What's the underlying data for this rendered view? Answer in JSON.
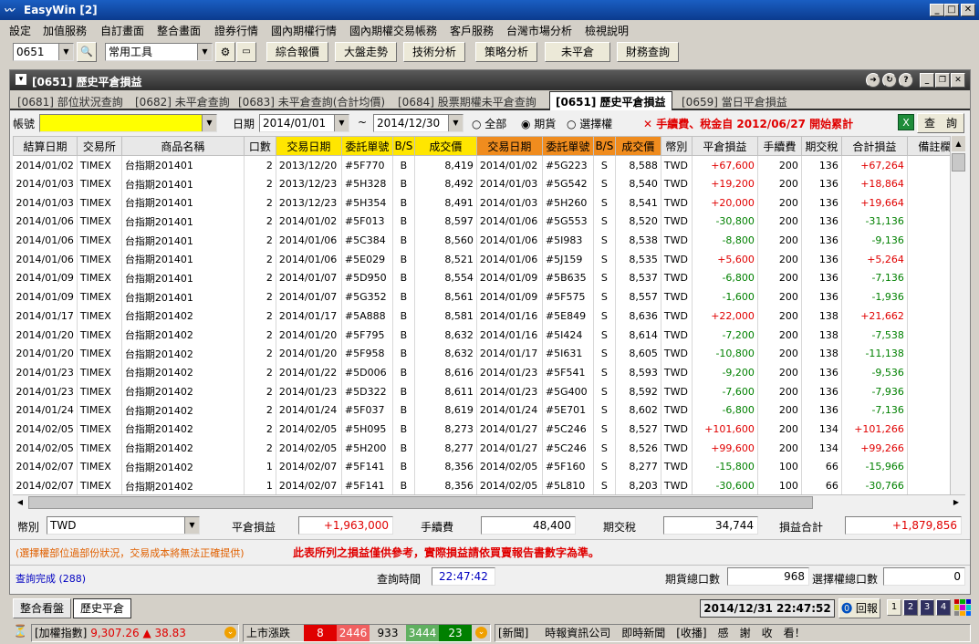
{
  "window": {
    "title": "EasyWin  [2]"
  },
  "menu": [
    "設定",
    "加值服務",
    "自訂畫面",
    "整合畫面",
    "證券行情",
    "國內期權行情",
    "國內期權交易帳務",
    "客戶服務",
    "台灣市場分析",
    "檢視說明"
  ],
  "toolbar": {
    "code": "0651",
    "tools": "常用工具",
    "buttons": [
      "綜合報價",
      "大盤走勢",
      "技術分析",
      "策略分析",
      "未平倉",
      "財務查詢"
    ]
  },
  "panel": {
    "title": "[0651] 歷史平倉損益"
  },
  "tabs": [
    "[0681] 部位狀況查詢",
    "[0682] 未平倉查詢",
    "[0683] 未平倉查詢(合計均價)",
    "[0684] 股票期權未平倉查詢",
    "[0651] 歷史平倉損益",
    "[0659] 當日平倉損益"
  ],
  "filter": {
    "account_label": "帳號",
    "date_label": "日期",
    "date_from": "2014/01/01",
    "tilde": "~",
    "date_to": "2014/12/30",
    "opt_all": "全部",
    "opt_futures": "期貨",
    "opt_options": "選擇權",
    "notice": "✕ 手續費、稅金自 2012/06/27 開始累計",
    "query_button": "查　詢"
  },
  "table": {
    "headers": [
      "結算日期",
      "交易所",
      "商品名稱",
      "口數",
      "交易日期",
      "委託單號",
      "B/S",
      "成交價",
      "交易日期",
      "委託單號",
      "B/S",
      "成交價",
      "幣別",
      "平倉損益",
      "手續費",
      "期交稅",
      "合計損益",
      "備註欄"
    ],
    "rows": [
      [
        "2014/01/02",
        "TIMEX",
        "台指期201401",
        "2",
        "2013/12/20",
        "#5F770",
        "B",
        "8,419",
        "2014/01/02",
        "#5G223",
        "S",
        "8,588",
        "TWD",
        "+67,600",
        "200",
        "136",
        "+67,264",
        ""
      ],
      [
        "2014/01/03",
        "TIMEX",
        "台指期201401",
        "2",
        "2013/12/23",
        "#5H328",
        "B",
        "8,492",
        "2014/01/03",
        "#5G542",
        "S",
        "8,540",
        "TWD",
        "+19,200",
        "200",
        "136",
        "+18,864",
        ""
      ],
      [
        "2014/01/03",
        "TIMEX",
        "台指期201401",
        "2",
        "2013/12/23",
        "#5H354",
        "B",
        "8,491",
        "2014/01/03",
        "#5H260",
        "S",
        "8,541",
        "TWD",
        "+20,000",
        "200",
        "136",
        "+19,664",
        ""
      ],
      [
        "2014/01/06",
        "TIMEX",
        "台指期201401",
        "2",
        "2014/01/02",
        "#5F013",
        "B",
        "8,597",
        "2014/01/06",
        "#5G553",
        "S",
        "8,520",
        "TWD",
        "-30,800",
        "200",
        "136",
        "-31,136",
        ""
      ],
      [
        "2014/01/06",
        "TIMEX",
        "台指期201401",
        "2",
        "2014/01/06",
        "#5C384",
        "B",
        "8,560",
        "2014/01/06",
        "#5I983",
        "S",
        "8,538",
        "TWD",
        "-8,800",
        "200",
        "136",
        "-9,136",
        ""
      ],
      [
        "2014/01/06",
        "TIMEX",
        "台指期201401",
        "2",
        "2014/01/06",
        "#5E029",
        "B",
        "8,521",
        "2014/01/06",
        "#5J159",
        "S",
        "8,535",
        "TWD",
        "+5,600",
        "200",
        "136",
        "+5,264",
        ""
      ],
      [
        "2014/01/09",
        "TIMEX",
        "台指期201401",
        "2",
        "2014/01/07",
        "#5D950",
        "B",
        "8,554",
        "2014/01/09",
        "#5B635",
        "S",
        "8,537",
        "TWD",
        "-6,800",
        "200",
        "136",
        "-7,136",
        ""
      ],
      [
        "2014/01/09",
        "TIMEX",
        "台指期201401",
        "2",
        "2014/01/07",
        "#5G352",
        "B",
        "8,561",
        "2014/01/09",
        "#5F575",
        "S",
        "8,557",
        "TWD",
        "-1,600",
        "200",
        "136",
        "-1,936",
        ""
      ],
      [
        "2014/01/17",
        "TIMEX",
        "台指期201402",
        "2",
        "2014/01/17",
        "#5A888",
        "B",
        "8,581",
        "2014/01/16",
        "#5E849",
        "S",
        "8,636",
        "TWD",
        "+22,000",
        "200",
        "138",
        "+21,662",
        ""
      ],
      [
        "2014/01/20",
        "TIMEX",
        "台指期201402",
        "2",
        "2014/01/20",
        "#5F795",
        "B",
        "8,632",
        "2014/01/16",
        "#5I424",
        "S",
        "8,614",
        "TWD",
        "-7,200",
        "200",
        "138",
        "-7,538",
        ""
      ],
      [
        "2014/01/20",
        "TIMEX",
        "台指期201402",
        "2",
        "2014/01/20",
        "#5F958",
        "B",
        "8,632",
        "2014/01/17",
        "#5I631",
        "S",
        "8,605",
        "TWD",
        "-10,800",
        "200",
        "138",
        "-11,138",
        ""
      ],
      [
        "2014/01/23",
        "TIMEX",
        "台指期201402",
        "2",
        "2014/01/22",
        "#5D006",
        "B",
        "8,616",
        "2014/01/23",
        "#5F541",
        "S",
        "8,593",
        "TWD",
        "-9,200",
        "200",
        "136",
        "-9,536",
        ""
      ],
      [
        "2014/01/23",
        "TIMEX",
        "台指期201402",
        "2",
        "2014/01/23",
        "#5D322",
        "B",
        "8,611",
        "2014/01/23",
        "#5G400",
        "S",
        "8,592",
        "TWD",
        "-7,600",
        "200",
        "136",
        "-7,936",
        ""
      ],
      [
        "2014/01/24",
        "TIMEX",
        "台指期201402",
        "2",
        "2014/01/24",
        "#5F037",
        "B",
        "8,619",
        "2014/01/24",
        "#5E701",
        "S",
        "8,602",
        "TWD",
        "-6,800",
        "200",
        "136",
        "-7,136",
        ""
      ],
      [
        "2014/02/05",
        "TIMEX",
        "台指期201402",
        "2",
        "2014/02/05",
        "#5H095",
        "B",
        "8,273",
        "2014/01/27",
        "#5C246",
        "S",
        "8,527",
        "TWD",
        "+101,600",
        "200",
        "134",
        "+101,266",
        ""
      ],
      [
        "2014/02/05",
        "TIMEX",
        "台指期201402",
        "2",
        "2014/02/05",
        "#5H200",
        "B",
        "8,277",
        "2014/01/27",
        "#5C246",
        "S",
        "8,526",
        "TWD",
        "+99,600",
        "200",
        "134",
        "+99,266",
        ""
      ],
      [
        "2014/02/07",
        "TIMEX",
        "台指期201402",
        "1",
        "2014/02/07",
        "#5F141",
        "B",
        "8,356",
        "2014/02/05",
        "#5F160",
        "S",
        "8,277",
        "TWD",
        "-15,800",
        "100",
        "66",
        "-15,966",
        ""
      ],
      [
        "2014/02/07",
        "TIMEX",
        "台指期201402",
        "1",
        "2014/02/07",
        "#5F141",
        "B",
        "8,356",
        "2014/02/05",
        "#5L810",
        "S",
        "8,203",
        "TWD",
        "-30,600",
        "100",
        "66",
        "-30,766",
        ""
      ]
    ]
  },
  "summary": {
    "currency_label": "幣別",
    "currency": "TWD",
    "pnl_label": "平倉損益",
    "pnl": "+1,963,000",
    "fee_label": "手續費",
    "fee": "48,400",
    "tax_label": "期交稅",
    "tax": "34,744",
    "total_label": "損益合計",
    "total": "+1,879,856"
  },
  "notes": {
    "left": "(選擇權部位過部份狀況，交易成本將無法正確提供)",
    "warning": "此表所列之損益僅供參考，實際損益請依買賣報告書數字為準。"
  },
  "query": {
    "status": "查詢完成 (288)",
    "time_label": "查詢時間",
    "time": "22:47:42",
    "fut_label": "期貨總口數",
    "fut": "968",
    "opt_label": "選擇權總口數",
    "opt": "0"
  },
  "bottomtabs": [
    "整合看盤",
    "歷史平倉"
  ],
  "clock": "2014/12/31 22:47:52",
  "back_label": "回報",
  "page_buttons": [
    "1",
    "2",
    "3",
    "4"
  ],
  "statusbar": {
    "index_label": "[加權指數]",
    "index": "9,307.26",
    "change_arrow": "▲",
    "change": "38.83",
    "breadth_label": "上市漲跌",
    "limit_up": "8",
    "up": "2446",
    "flat": "933",
    "down": "3444",
    "limit_down": "23",
    "news_label": "[新聞]",
    "ticker": "時報資訊公司　即時新聞　[收播]　感　謝　收　看！"
  }
}
